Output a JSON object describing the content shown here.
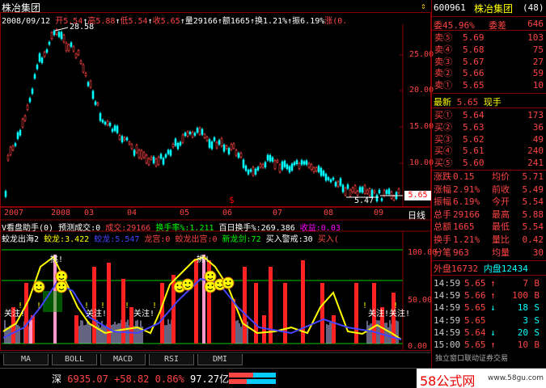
{
  "header": {
    "stock_name": "株冶集团",
    "date": "2008/09/12",
    "open": "开5.54",
    "high": "高5.88",
    "low": "低5.54",
    "close": "收5.65",
    "volume": "量29166",
    "amount": "额1665",
    "turnover": "换1.21%",
    "amplitude": "振6.19%",
    "change": "涨(0."
  },
  "price_chart": {
    "y_ticks": [
      "25.00",
      "20.00",
      "15.00",
      "10.00"
    ],
    "x_ticks": [
      "2007",
      "2008",
      "03",
      "04",
      "05",
      "06",
      "07",
      "08",
      "09"
    ],
    "max_label": "28.58",
    "min_label": "5.47",
    "current_price": "5.65",
    "period": "日线"
  },
  "indicator1": {
    "row1": [
      "V看盘助手(0)",
      "预测成交:0",
      "成交:29166",
      "换手率%:1.211",
      "百日换手%:269.386",
      "收益:0.03"
    ],
    "row2": [
      "蛟龙出海2",
      "蛟龙:3.422",
      "蛟龙:5.547",
      "龙宫:0",
      "蛟龙出宫:0",
      "新龙剑:72",
      "买入警戒:30",
      "买入("
    ],
    "y_ticks": [
      "100.00",
      "50.00",
      "0.00"
    ],
    "labels": [
      "挑!",
      "挑!",
      "关注!",
      "关注!",
      "关注!",
      "关注!关注!"
    ]
  },
  "tabs": [
    "MA",
    "BOLL",
    "MACD",
    "RSI",
    "DMI"
  ],
  "sidebar": {
    "code": "600961",
    "name": "株冶集团",
    "count": "(48)",
    "ratio_label": "委",
    "ratio": "45.96%",
    "diff_label": "委差",
    "diff": "646",
    "sell": [
      {
        "label": "卖⑤",
        "price": "5.69",
        "vol": "103"
      },
      {
        "label": "卖④",
        "price": "5.68",
        "vol": "75"
      },
      {
        "label": "卖③",
        "price": "5.67",
        "vol": "27"
      },
      {
        "label": "卖②",
        "price": "5.66",
        "vol": "59"
      },
      {
        "label": "卖①",
        "price": "5.65",
        "vol": "10"
      }
    ],
    "latest_label": "最新",
    "latest": "5.65",
    "latest_suffix": "现手",
    "buy": [
      {
        "label": "买①",
        "price": "5.64",
        "vol": "173"
      },
      {
        "label": "买②",
        "price": "5.63",
        "vol": "36"
      },
      {
        "label": "买③",
        "price": "5.62",
        "vol": "49"
      },
      {
        "label": "买④",
        "price": "5.61",
        "vol": "240"
      },
      {
        "label": "买⑤",
        "price": "5.60",
        "vol": "241"
      }
    ],
    "stats": [
      {
        "l1": "涨跌",
        "v1": "0.15",
        "l2": "均价",
        "v2": "5.71"
      },
      {
        "l1": "涨幅",
        "v1": "2.91%",
        "l2": "前收",
        "v2": "5.49"
      },
      {
        "l1": "振幅",
        "v1": "6.19%",
        "l2": "今开",
        "v2": "5.54"
      },
      {
        "l1": "总手",
        "v1": "29166",
        "l2": "最高",
        "v2": "5.88"
      },
      {
        "l1": "总额",
        "v1": "1665",
        "l2": "最低",
        "v2": "5.54"
      },
      {
        "l1": "换手",
        "v1": "1.21%",
        "l2": "量比",
        "v2": "0.42"
      },
      {
        "l1": "分笔",
        "v1": "963",
        "l2": "均量",
        "v2": "30"
      }
    ],
    "outer_label": "外盘",
    "outer": "16732",
    "inner_label": "内盘",
    "inner": "12434",
    "ticks": [
      {
        "time": "14:59",
        "price": "5.65",
        "arrow": "↑",
        "vol": "7",
        "side": "B"
      },
      {
        "time": "14:59",
        "price": "5.66",
        "arrow": "↑",
        "vol": "100",
        "side": "B"
      },
      {
        "time": "14:59",
        "price": "5.65",
        "arrow": "↓",
        "vol": "18",
        "side": "S"
      },
      {
        "time": "14:59",
        "price": "5.65",
        "arrow": "",
        "vol": "3",
        "side": "S"
      },
      {
        "time": "14:59",
        "price": "5.64",
        "arrow": "↓",
        "vol": "20",
        "side": "S"
      },
      {
        "time": "15:00",
        "price": "5.65",
        "arrow": "↑",
        "vol": "10",
        "side": "B"
      }
    ],
    "footer_hint": "独立窗口联动证券交易"
  },
  "status_bar": {
    "market": "深",
    "index": "6935.07",
    "change": "+58.82",
    "pct": "0.86%",
    "amount": "97.27亿"
  },
  "watermark": {
    "brand": "58公式网",
    "url": "www.58gu.com"
  },
  "colors": {
    "up": "#ff4444",
    "down": "#00ffff",
    "frame": "#880000"
  }
}
